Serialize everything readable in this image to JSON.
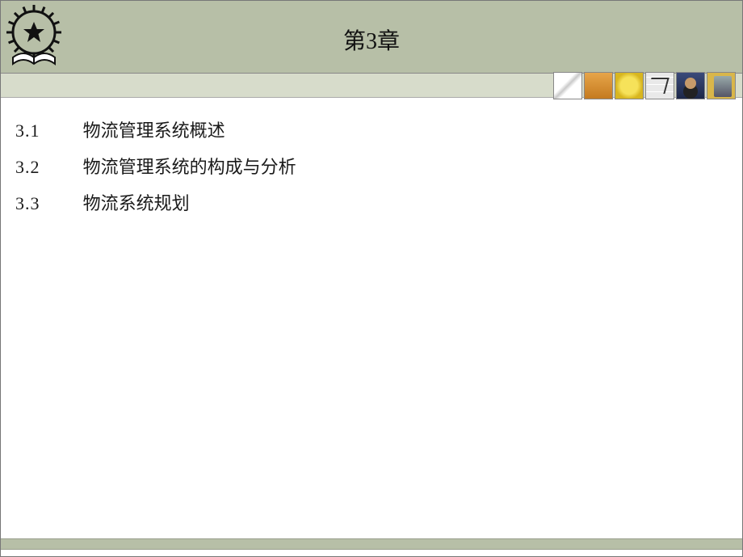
{
  "header": {
    "title": "第3章"
  },
  "toc": [
    {
      "num": "3.1",
      "text": "物流管理系统概述"
    },
    {
      "num": "3.2",
      "text": "物流管理系统的构成与分析"
    },
    {
      "num": "3.3",
      "text": "物流系统规划"
    }
  ],
  "thumbnails": [
    {
      "name": "compass-icon"
    },
    {
      "name": "hands-icon"
    },
    {
      "name": "compass-gold-icon"
    },
    {
      "name": "chart-grid-icon"
    },
    {
      "name": "person-suit-icon"
    },
    {
      "name": "buildings-icon"
    }
  ]
}
